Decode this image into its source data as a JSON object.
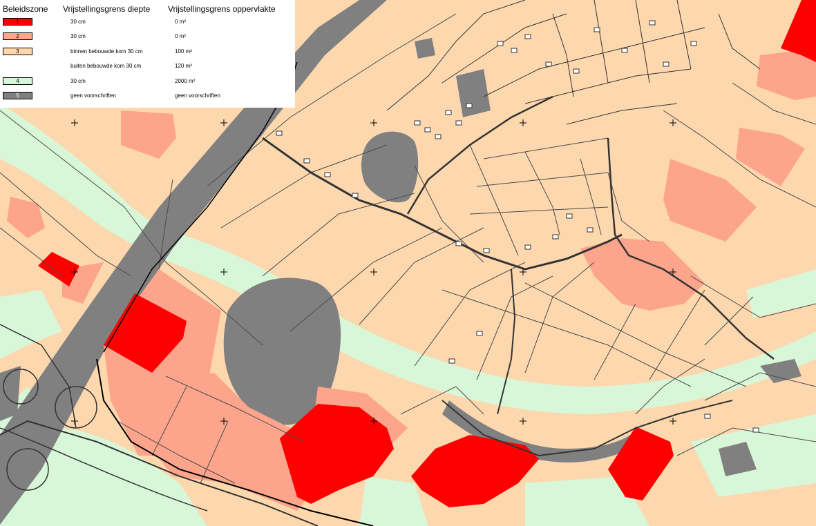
{
  "legend": {
    "headers": {
      "zone": "Beleidszone",
      "depth": "Vrijstellingsgrens diepte",
      "area": "Vrijstellingsgrens oppervlakte"
    },
    "rows": [
      {
        "zone": "1",
        "color": "#ff0000",
        "depth": "30 cm",
        "area": "0 m²"
      },
      {
        "zone": "2",
        "color": "#fca58c",
        "depth": "30 cm",
        "area": "0 m²"
      },
      {
        "zone": "3",
        "color": "#fdd7ad",
        "depth": "binnen bebouwde kom 30 cm",
        "area": "100 m²"
      },
      {
        "zone": "",
        "color": null,
        "depth": "buiten bebouwde kom 30 cm",
        "area": "120 m²"
      },
      {
        "zone": "4",
        "color": "#d8f7d8",
        "depth": "30 cm",
        "area": "2000 m²"
      },
      {
        "zone": "5",
        "color": "#808080",
        "depth": "geen voorschriften",
        "area": "geen voorschriften"
      }
    ]
  },
  "colors": {
    "zone1": "#ff0000",
    "zone2": "#fca58c",
    "zone3": "#fdd7ad",
    "zone4": "#d8f7d8",
    "zone5": "#808080",
    "lines": "#4a4a4a"
  },
  "grid_marker_icon": "crosshair-plus-icon"
}
